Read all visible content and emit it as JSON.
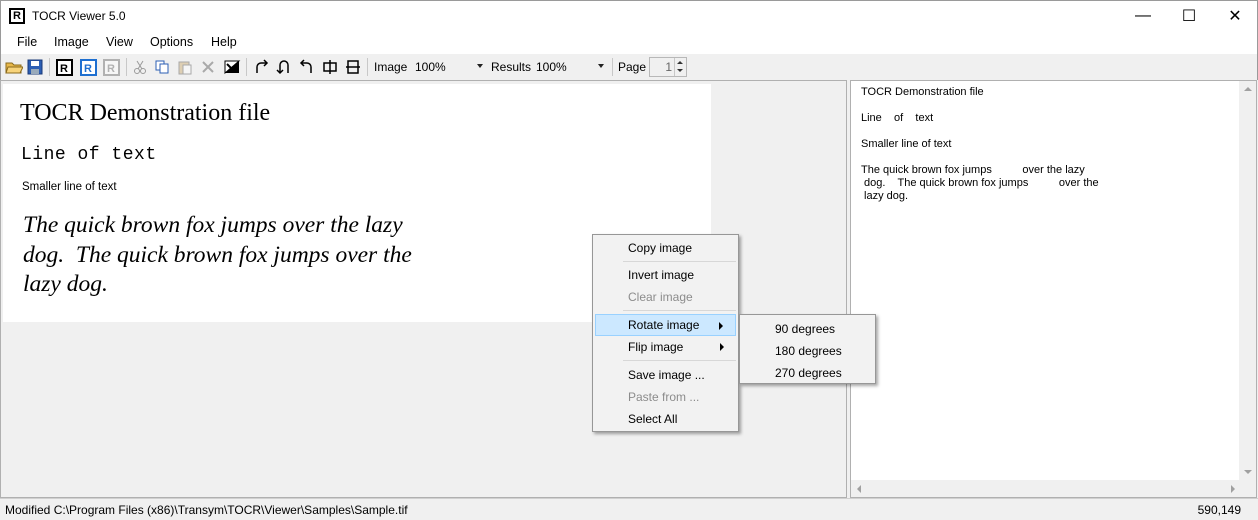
{
  "window": {
    "title": "TOCR Viewer 5.0",
    "app_icon_glyph": "R",
    "minimize_glyph": "—",
    "maximize_glyph": "☐",
    "close_glyph": "✕"
  },
  "menu": [
    "File",
    "Image",
    "View",
    "Options",
    "Help"
  ],
  "toolbar": {
    "icons": [
      "open-folder-icon",
      "save-icon",
      "read-icon",
      "read-selection-icon",
      "read-disabled-icon",
      "cut-icon",
      "copy-icon",
      "paste-icon",
      "delete-icon",
      "invert-icon",
      "rotate-right-icon",
      "flip-icon",
      "rotate-left-icon",
      "split-vertical-icon",
      "split-horizontal-icon"
    ],
    "image_label": "Image",
    "image_zoom": "100%",
    "results_label": "Results",
    "results_zoom": "100%",
    "page_label": "Page",
    "page_value": "1"
  },
  "document": {
    "title": "TOCR Demonstration file",
    "line": "Line of text",
    "small_line": "Smaller line of text",
    "paragraph_lines": [
      "The quick brown fox jumps over the lazy",
      "dog.  The quick brown fox jumps over the",
      "lazy dog."
    ]
  },
  "results": {
    "text": "TOCR Demonstration file\n\nLine    of    text\n\nSmaller line of text\n\nThe quick brown fox jumps          over the lazy\n dog.    The quick brown fox jumps          over the\n lazy dog."
  },
  "context_menu": {
    "items": [
      {
        "label": "Copy image",
        "enabled": true
      },
      {
        "label": "Invert image",
        "enabled": true
      },
      {
        "label": "Clear image",
        "enabled": false
      },
      {
        "label": "Rotate image",
        "enabled": true,
        "submenu": true,
        "active": true
      },
      {
        "label": "Flip image",
        "enabled": true,
        "submenu": true
      },
      {
        "label": "Save image ...",
        "enabled": true
      },
      {
        "label": "Paste from ...",
        "enabled": false
      },
      {
        "label": "Select All",
        "enabled": true
      }
    ],
    "submenu": [
      "90 degrees",
      "180 degrees",
      "270 degrees"
    ]
  },
  "status": {
    "text": "Modified C:\\Program Files (x86)\\Transym\\TOCR\\Viewer\\Samples\\Sample.tif",
    "coords": "590,149"
  },
  "colors": {
    "menu_highlight": "#cce8ff",
    "menu_highlight_border": "#99d1ff",
    "chrome": "#f0f0f0"
  }
}
